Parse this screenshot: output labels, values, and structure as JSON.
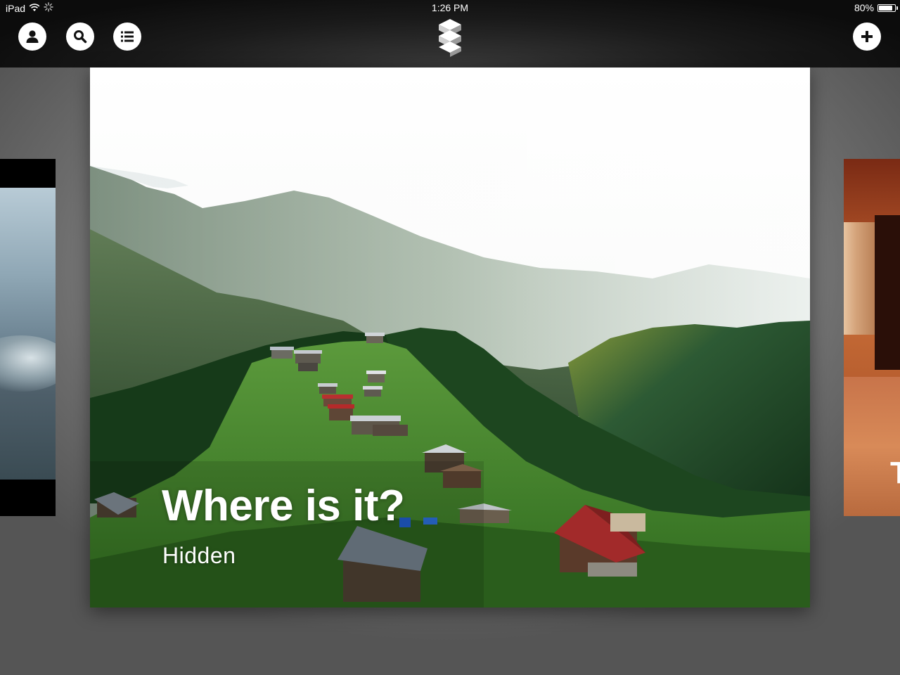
{
  "status_bar": {
    "device": "iPad",
    "time": "1:26 PM",
    "battery": "80%"
  },
  "toolbar": {
    "profile_icon": "person-icon",
    "search_icon": "search-icon",
    "list_icon": "list-icon",
    "logo_icon": "stacked-cubes-logo",
    "add_icon": "plus-icon"
  },
  "cards": {
    "main": {
      "title": "Where is it?",
      "subtitle": "Hidden"
    },
    "right_peek_text": "T"
  }
}
